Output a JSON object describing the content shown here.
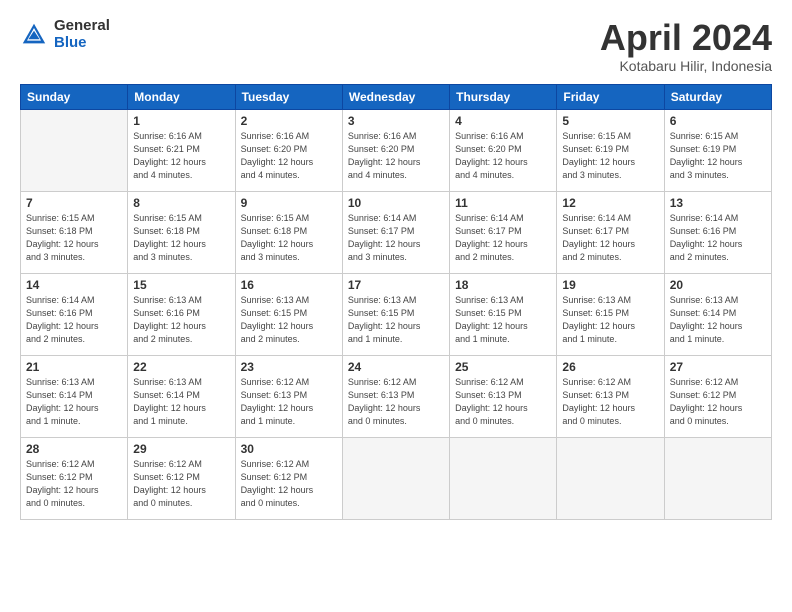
{
  "header": {
    "logo_general": "General",
    "logo_blue": "Blue",
    "month_title": "April 2024",
    "location": "Kotabaru Hilir, Indonesia"
  },
  "weekdays": [
    "Sunday",
    "Monday",
    "Tuesday",
    "Wednesday",
    "Thursday",
    "Friday",
    "Saturday"
  ],
  "weeks": [
    [
      {
        "day": "",
        "empty": true
      },
      {
        "day": "1",
        "sunrise": "6:16 AM",
        "sunset": "6:21 PM",
        "daylight": "12 hours and 4 minutes."
      },
      {
        "day": "2",
        "sunrise": "6:16 AM",
        "sunset": "6:20 PM",
        "daylight": "12 hours and 4 minutes."
      },
      {
        "day": "3",
        "sunrise": "6:16 AM",
        "sunset": "6:20 PM",
        "daylight": "12 hours and 4 minutes."
      },
      {
        "day": "4",
        "sunrise": "6:16 AM",
        "sunset": "6:20 PM",
        "daylight": "12 hours and 4 minutes."
      },
      {
        "day": "5",
        "sunrise": "6:15 AM",
        "sunset": "6:19 PM",
        "daylight": "12 hours and 3 minutes."
      },
      {
        "day": "6",
        "sunrise": "6:15 AM",
        "sunset": "6:19 PM",
        "daylight": "12 hours and 3 minutes."
      }
    ],
    [
      {
        "day": "7",
        "sunrise": "6:15 AM",
        "sunset": "6:18 PM",
        "daylight": "12 hours and 3 minutes."
      },
      {
        "day": "8",
        "sunrise": "6:15 AM",
        "sunset": "6:18 PM",
        "daylight": "12 hours and 3 minutes."
      },
      {
        "day": "9",
        "sunrise": "6:15 AM",
        "sunset": "6:18 PM",
        "daylight": "12 hours and 3 minutes."
      },
      {
        "day": "10",
        "sunrise": "6:14 AM",
        "sunset": "6:17 PM",
        "daylight": "12 hours and 3 minutes."
      },
      {
        "day": "11",
        "sunrise": "6:14 AM",
        "sunset": "6:17 PM",
        "daylight": "12 hours and 2 minutes."
      },
      {
        "day": "12",
        "sunrise": "6:14 AM",
        "sunset": "6:17 PM",
        "daylight": "12 hours and 2 minutes."
      },
      {
        "day": "13",
        "sunrise": "6:14 AM",
        "sunset": "6:16 PM",
        "daylight": "12 hours and 2 minutes."
      }
    ],
    [
      {
        "day": "14",
        "sunrise": "6:14 AM",
        "sunset": "6:16 PM",
        "daylight": "12 hours and 2 minutes."
      },
      {
        "day": "15",
        "sunrise": "6:13 AM",
        "sunset": "6:16 PM",
        "daylight": "12 hours and 2 minutes."
      },
      {
        "day": "16",
        "sunrise": "6:13 AM",
        "sunset": "6:15 PM",
        "daylight": "12 hours and 2 minutes."
      },
      {
        "day": "17",
        "sunrise": "6:13 AM",
        "sunset": "6:15 PM",
        "daylight": "12 hours and 1 minute."
      },
      {
        "day": "18",
        "sunrise": "6:13 AM",
        "sunset": "6:15 PM",
        "daylight": "12 hours and 1 minute."
      },
      {
        "day": "19",
        "sunrise": "6:13 AM",
        "sunset": "6:15 PM",
        "daylight": "12 hours and 1 minute."
      },
      {
        "day": "20",
        "sunrise": "6:13 AM",
        "sunset": "6:14 PM",
        "daylight": "12 hours and 1 minute."
      }
    ],
    [
      {
        "day": "21",
        "sunrise": "6:13 AM",
        "sunset": "6:14 PM",
        "daylight": "12 hours and 1 minute."
      },
      {
        "day": "22",
        "sunrise": "6:13 AM",
        "sunset": "6:14 PM",
        "daylight": "12 hours and 1 minute."
      },
      {
        "day": "23",
        "sunrise": "6:12 AM",
        "sunset": "6:13 PM",
        "daylight": "12 hours and 1 minute."
      },
      {
        "day": "24",
        "sunrise": "6:12 AM",
        "sunset": "6:13 PM",
        "daylight": "12 hours and 0 minutes."
      },
      {
        "day": "25",
        "sunrise": "6:12 AM",
        "sunset": "6:13 PM",
        "daylight": "12 hours and 0 minutes."
      },
      {
        "day": "26",
        "sunrise": "6:12 AM",
        "sunset": "6:13 PM",
        "daylight": "12 hours and 0 minutes."
      },
      {
        "day": "27",
        "sunrise": "6:12 AM",
        "sunset": "6:12 PM",
        "daylight": "12 hours and 0 minutes."
      }
    ],
    [
      {
        "day": "28",
        "sunrise": "6:12 AM",
        "sunset": "6:12 PM",
        "daylight": "12 hours and 0 minutes."
      },
      {
        "day": "29",
        "sunrise": "6:12 AM",
        "sunset": "6:12 PM",
        "daylight": "12 hours and 0 minutes."
      },
      {
        "day": "30",
        "sunrise": "6:12 AM",
        "sunset": "6:12 PM",
        "daylight": "12 hours and 0 minutes."
      },
      {
        "day": "",
        "empty": true
      },
      {
        "day": "",
        "empty": true
      },
      {
        "day": "",
        "empty": true
      },
      {
        "day": "",
        "empty": true
      }
    ]
  ]
}
